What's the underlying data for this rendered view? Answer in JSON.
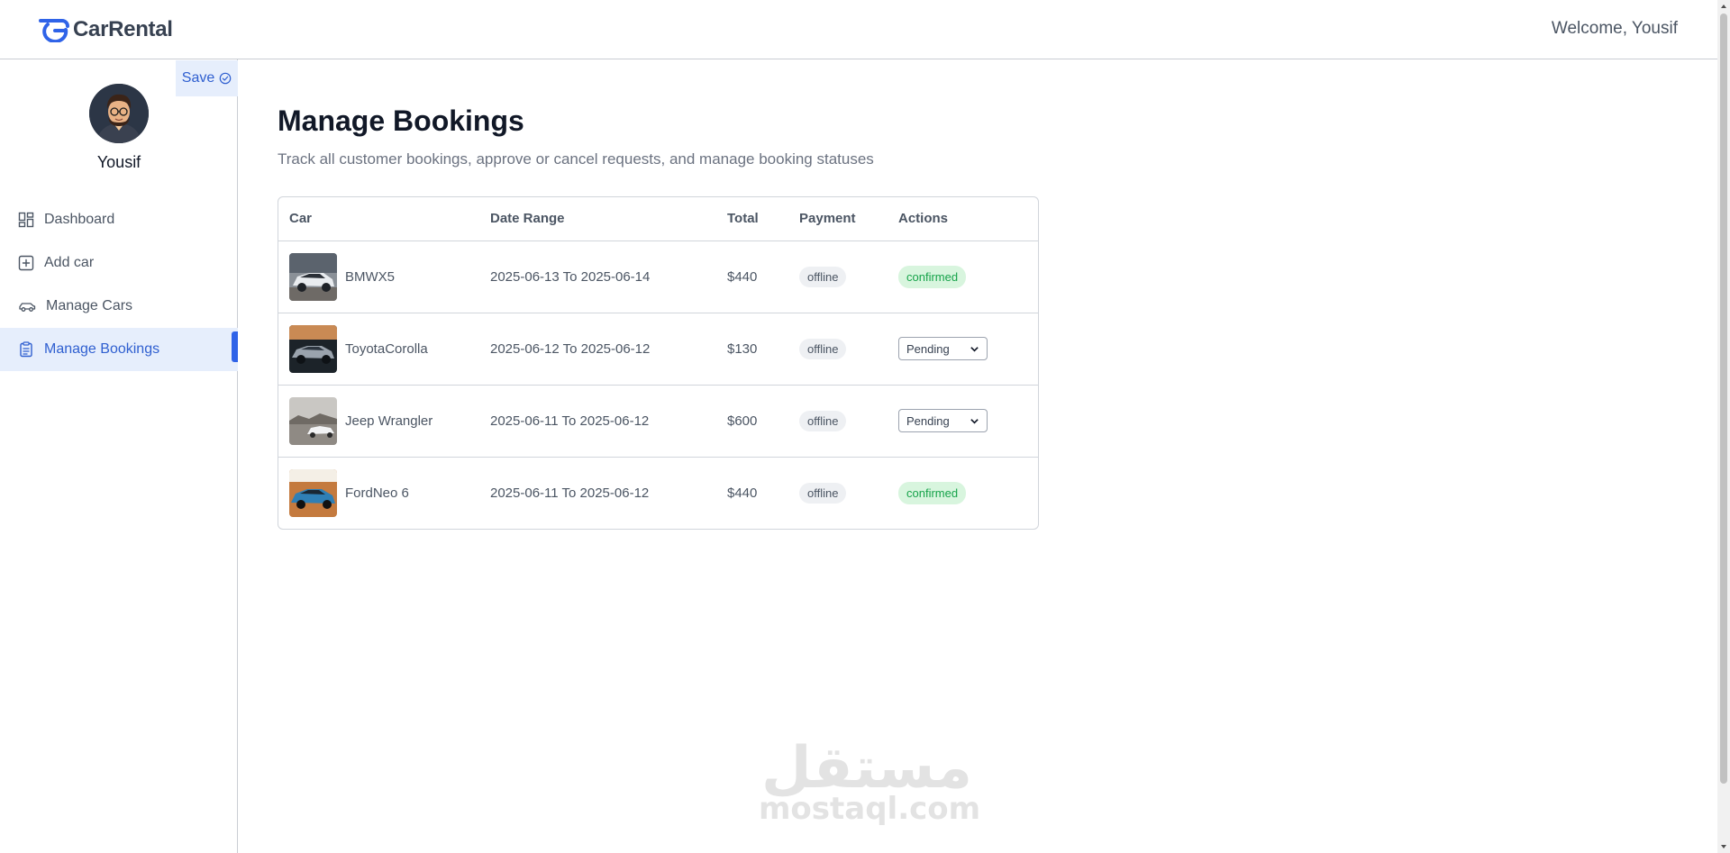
{
  "header": {
    "logo_text": "CarRental",
    "welcome": "Welcome, Yousif"
  },
  "sidebar": {
    "save_label": "Save",
    "user_name": "Yousif",
    "items": [
      {
        "label": "Dashboard",
        "icon": "dashboard-icon"
      },
      {
        "label": "Add car",
        "icon": "add-square-icon"
      },
      {
        "label": "Manage Cars",
        "icon": "car-icon"
      },
      {
        "label": "Manage Bookings",
        "icon": "clipboard-icon",
        "active": true
      }
    ]
  },
  "main": {
    "title": "Manage Bookings",
    "subtitle": "Track all customer bookings, approve or cancel requests, and manage booking statuses",
    "columns": [
      "Car",
      "Date Range",
      "Total",
      "Payment",
      "Actions"
    ],
    "rows": [
      {
        "car": "BMWX5",
        "date_range": "2025-06-13 To 2025-06-14",
        "total": "$440",
        "payment": "offline",
        "status": "confirmed",
        "action_type": "badge"
      },
      {
        "car": "ToyotaCorolla",
        "date_range": "2025-06-12 To 2025-06-12",
        "total": "$130",
        "payment": "offline",
        "status": "Pending",
        "action_type": "select"
      },
      {
        "car": "Jeep Wrangler",
        "date_range": "2025-06-11 To 2025-06-12",
        "total": "$600",
        "payment": "offline",
        "status": "Pending",
        "action_type": "select"
      },
      {
        "car": "FordNeo 6",
        "date_range": "2025-06-11 To 2025-06-12",
        "total": "$440",
        "payment": "offline",
        "status": "confirmed",
        "action_type": "badge"
      }
    ]
  },
  "watermark": {
    "arabic": "مستقل",
    "latin": "mostaql.com"
  },
  "colors": {
    "accent": "#2f63e8",
    "active_bg": "#e6eefc",
    "confirmed_bg": "#d8f5de",
    "confirmed_text": "#16a34a"
  }
}
